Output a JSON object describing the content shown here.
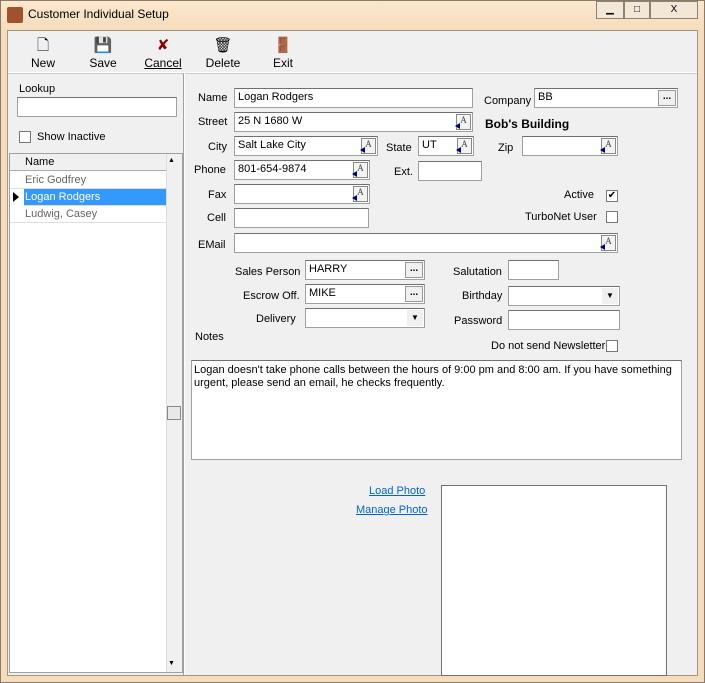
{
  "window": {
    "title": "Customer Individual Setup",
    "minimize": "▁",
    "maximize": "□",
    "close": "X"
  },
  "toolbar": [
    {
      "label": "New",
      "icon": "new-document-icon",
      "glyph": "🗋"
    },
    {
      "label": "Save",
      "icon": "floppy-disk-icon",
      "glyph": "💾"
    },
    {
      "label": "Cancel",
      "icon": "x-icon",
      "glyph": "✘"
    },
    {
      "label": "Delete",
      "icon": "trash-icon",
      "glyph": "🗑"
    },
    {
      "label": "Exit",
      "icon": "exit-door-icon",
      "glyph": "🚪"
    }
  ],
  "left": {
    "lookup_label": "Lookup",
    "lookup_value": "",
    "show_inactive": "Show Inactive",
    "grid_header": "Name",
    "rows": [
      "Eric Godfrey",
      "Logan Rodgers",
      "Ludwig, Casey"
    ],
    "selected": 1
  },
  "form": {
    "name_label": "Name",
    "name": "Logan Rodgers",
    "company_label": "Company",
    "company": "BB",
    "company_name": "Bob's Building",
    "street_label": "Street",
    "street": "25 N 1680 W",
    "city_label": "City",
    "city": "Salt Lake City",
    "state_label": "State",
    "state": "UT",
    "zip_label": "Zip",
    "zip": "",
    "phone_label": "Phone",
    "phone": "801-654-9874",
    "ext_label": "Ext.",
    "ext": "",
    "fax_label": "Fax",
    "fax": "",
    "cell_label": "Cell",
    "cell": "",
    "active_label": "Active",
    "active": "✔",
    "turbonet_label": "TurboNet User",
    "email_label": "EMail",
    "email": "",
    "salesperson_label": "Sales Person",
    "salesperson": "HARRY",
    "escrow_label": "Escrow Off.",
    "escrow": "MIKE",
    "delivery_label": "Delivery",
    "delivery": "",
    "salutation_label": "Salutation",
    "salutation": "",
    "birthday_label": "Birthday",
    "birthday": "",
    "password_label": "Password",
    "password": "",
    "newsletter_label": "Do not send Newsletter",
    "notes_label": "Notes",
    "notes": "Logan doesn't take phone calls between the hours of 9:00 pm and 8:00 am. If you have something urgent, please send an email, he checks frequently.",
    "load_photo": "Load Photo",
    "manage_photo": "Manage Photo"
  }
}
